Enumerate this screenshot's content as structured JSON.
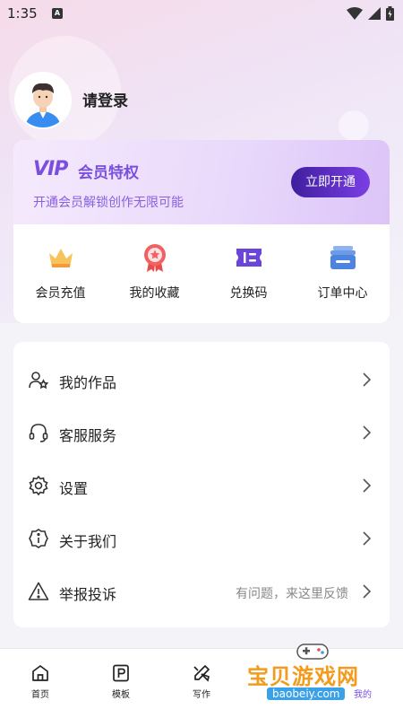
{
  "status_bar": {
    "time": "1:35",
    "badge": "A"
  },
  "profile": {
    "login_label": "请登录"
  },
  "vip": {
    "logo": "VIP",
    "title": "会员特权",
    "desc": "开通会员解锁创作无限可能",
    "button": "立即开通",
    "accent": "#7a4fe0"
  },
  "quick_actions": [
    {
      "label": "会员充值",
      "icon": "crown-icon"
    },
    {
      "label": "我的收藏",
      "icon": "medal-icon"
    },
    {
      "label": "兑换码",
      "icon": "ticket-icon"
    },
    {
      "label": "订单中心",
      "icon": "order-stack-icon"
    }
  ],
  "menu": [
    {
      "label": "我的作品",
      "icon": "user-star-icon",
      "hint": ""
    },
    {
      "label": "客服服务",
      "icon": "headset-icon",
      "hint": ""
    },
    {
      "label": "设置",
      "icon": "gear-icon",
      "hint": ""
    },
    {
      "label": "关于我们",
      "icon": "info-badge-icon",
      "hint": ""
    },
    {
      "label": "举报投诉",
      "icon": "warning-icon",
      "hint": "有问题，来这里反馈"
    }
  ],
  "bottom_nav": [
    {
      "label": "首页",
      "icon": "home-icon"
    },
    {
      "label": "模板",
      "icon": "template-icon"
    },
    {
      "label": "写作",
      "icon": "pencil-ruler-icon"
    },
    {
      "label": "",
      "icon": ""
    },
    {
      "label": "我的",
      "icon": "profile-icon"
    }
  ],
  "watermark": {
    "text": "宝贝游戏网",
    "url": "baobeiy.com"
  }
}
